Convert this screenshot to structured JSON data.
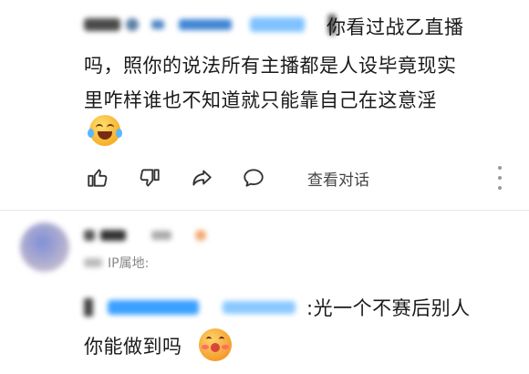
{
  "reply": {
    "header_text": "你看过战乙直播",
    "body_line2": "吗，照你的说法所有主播都是人设毕竟现实",
    "body_line3": "里咋样谁也不知道就只能靠自己在这意淫",
    "emoji": "laughing-crying-emoji",
    "actions": {
      "view_conversation": "查看对话"
    },
    "icons": [
      "thumbs-up-icon",
      "thumbs-down-icon",
      "share-icon",
      "comment-icon",
      "more-vertical-icon"
    ]
  },
  "comment2": {
    "meta_label": "IP属地:",
    "body_text1": ":光一个不赛后别人",
    "body_line2": "你能做到吗",
    "emoji": "blushing-emoji"
  }
}
